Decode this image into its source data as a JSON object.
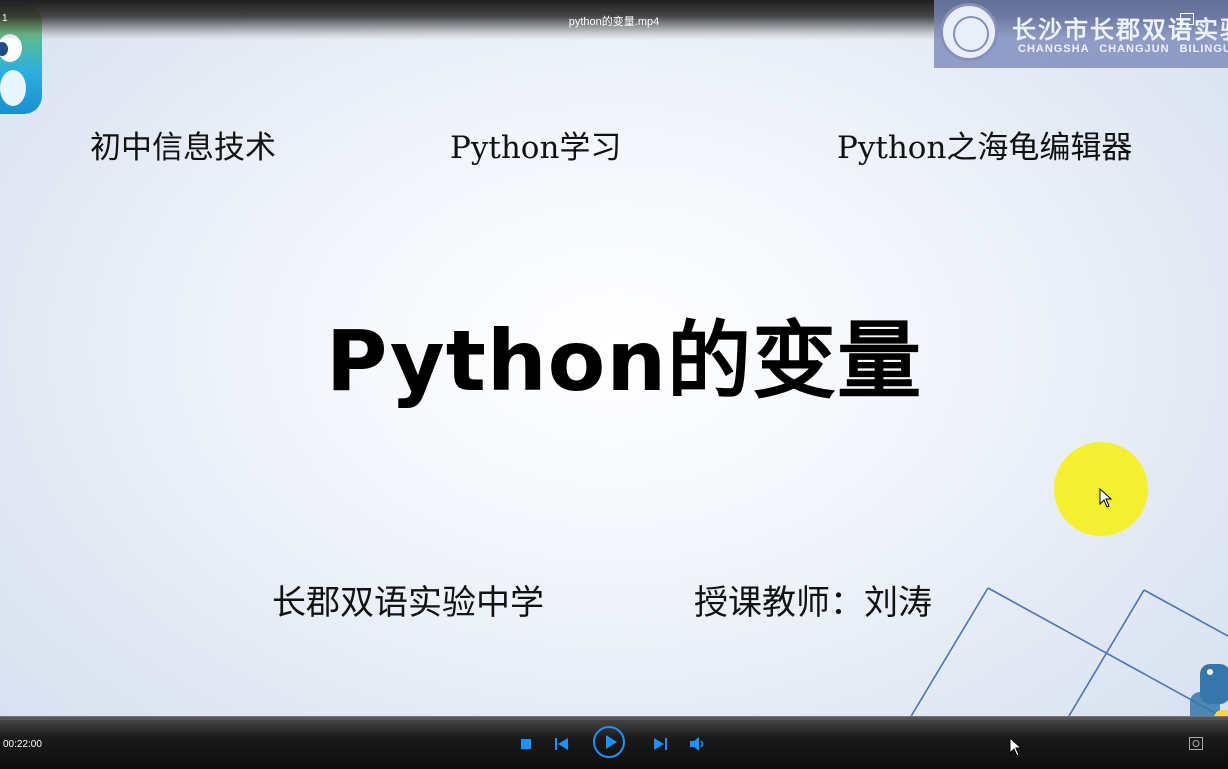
{
  "window": {
    "file_title": "python的变量.mp4",
    "corner_number": "1"
  },
  "banner": {
    "school_cn": "长沙市长郡双语实验",
    "school_en": "CHANGSHA CHANGJUN BILINGUAL"
  },
  "slide": {
    "top_left": "初中信息技术",
    "top_center": "Python学习",
    "top_right": "Python之海龟编辑器",
    "title": "Python的变量",
    "school": "长郡双语实验中学",
    "teacher": "授课教师：刘涛"
  },
  "player": {
    "time": "00:22:00",
    "progress": 0.0,
    "accent_color": "#1e90ff",
    "icons": [
      "stop-icon",
      "previous-icon",
      "play-icon",
      "next-icon",
      "volume-icon",
      "screenshot-icon",
      "fullscreen-icon"
    ]
  },
  "colors": {
    "highlight": "#f5f01f",
    "deco_lines": "#4a73b8",
    "banner": "#7887b9"
  }
}
